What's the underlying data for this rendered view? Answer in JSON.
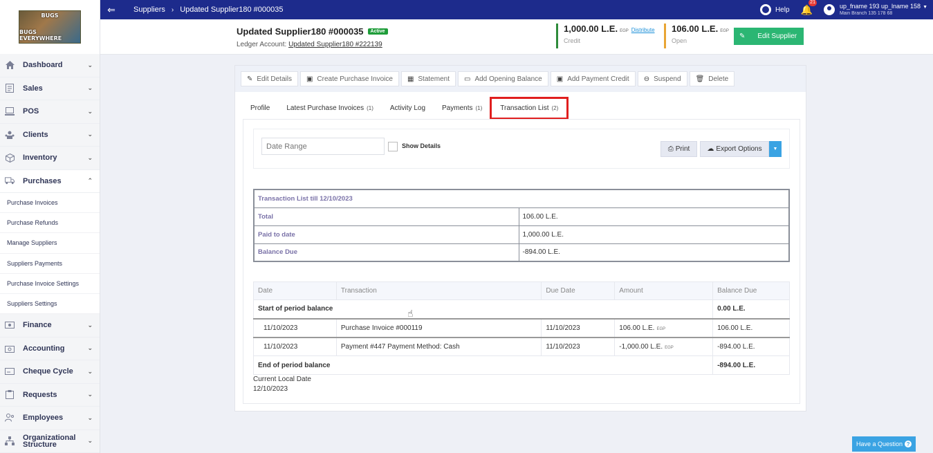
{
  "logo": {
    "line1": "BUGS",
    "line2": "BUGS EVERYWHERE"
  },
  "topbar": {
    "breadcrumb": [
      "Suppliers",
      "Updated Supplier180 #000035"
    ],
    "help": "Help",
    "notifications": "21",
    "user_name": "up_fname 193 up_lname 158",
    "user_branch": "Main Branch 135 178 68"
  },
  "sidebar": {
    "items": [
      {
        "label": "Dashboard",
        "icon": "home-icon"
      },
      {
        "label": "Sales",
        "icon": "sales-icon"
      },
      {
        "label": "POS",
        "icon": "pos-icon"
      },
      {
        "label": "Clients",
        "icon": "clients-icon"
      },
      {
        "label": "Inventory",
        "icon": "box-icon"
      },
      {
        "label": "Purchases",
        "icon": "truck-icon"
      }
    ],
    "purchases_sub": [
      "Purchase Invoices",
      "Purchase Refunds",
      "Manage Suppliers",
      "Suppliers Payments",
      "Purchase Invoice Settings",
      "Suppliers Settings"
    ],
    "items_after": [
      {
        "label": "Finance",
        "icon": "finance-icon"
      },
      {
        "label": "Accounting",
        "icon": "accounting-icon"
      },
      {
        "label": "Cheque Cycle",
        "icon": "cheque-icon"
      },
      {
        "label": "Requests",
        "icon": "requests-icon"
      },
      {
        "label": "Employees",
        "icon": "employees-icon"
      },
      {
        "label": "Organizational Structure",
        "icon": "org-icon"
      }
    ]
  },
  "supplier": {
    "title": "Updated Supplier180 #000035",
    "status": "Active",
    "ledger_label": "Ledger Account:",
    "ledger_link": "Updated Supplier180 #222139",
    "credit_value": "1,000.00 L.E.",
    "credit_currency": "EGP",
    "distribute": "Distribute",
    "credit_label": "Credit",
    "open_value": "106.00 L.E.",
    "open_currency": "EGP",
    "open_label": "Open",
    "edit_button": "Edit Supplier"
  },
  "toolbar": [
    "Edit Details",
    "Create Purchase Invoice",
    "Statement",
    "Add Opening Balance",
    "Add Payment Credit",
    "Suspend",
    "Delete"
  ],
  "tabs": {
    "profile": "Profile",
    "latest": "Latest Purchase Invoices",
    "latest_count": "(1)",
    "activity": "Activity Log",
    "payments": "Payments",
    "payments_count": "(1)",
    "transactions": "Transaction List",
    "transactions_count": "(2)"
  },
  "filter": {
    "date_placeholder": "Date Range",
    "show_details": "Show Details",
    "print": "Print",
    "export": "Export Options"
  },
  "summary": {
    "header": "Transaction List till 12/10/2023",
    "rows": [
      {
        "k": "Total",
        "v": "106.00 L.E."
      },
      {
        "k": "Paid to date",
        "v": "1,000.00 L.E."
      },
      {
        "k": "Balance Due",
        "v": "-894.00 L.E."
      }
    ]
  },
  "transactions": {
    "headers": [
      "Date",
      "Transaction",
      "Due Date",
      "Amount",
      "Balance Due"
    ],
    "start_label": "Start of period balance",
    "start_balance": "0.00 L.E.",
    "rows": [
      {
        "date": "11/10/2023",
        "transaction": "Purchase Invoice #000119",
        "due": "11/10/2023",
        "amount": "106.00 L.E.",
        "currency": "EGP",
        "balance": "106.00 L.E."
      },
      {
        "date": "11/10/2023",
        "transaction": "Payment #447 Payment Method: Cash",
        "due": "11/10/2023",
        "amount": "-1,000.00 L.E.",
        "currency": "EGP",
        "balance": "-894.00 L.E."
      }
    ],
    "end_label": "End of period balance",
    "end_balance": "-894.00 L.E."
  },
  "local_date": {
    "label": "Current Local Date",
    "value": "12/10/2023"
  },
  "have_question": "Have a Question"
}
